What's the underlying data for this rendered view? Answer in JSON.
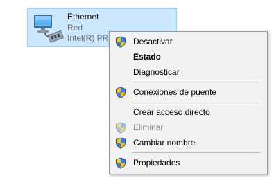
{
  "adapter": {
    "name": "Ethernet",
    "status": "Red",
    "device": "Intel(R) PRO"
  },
  "context_menu": {
    "items": [
      {
        "label": "Desactivar",
        "icon": "uac-shield-icon"
      },
      {
        "label": "Estado",
        "bold": true
      },
      {
        "label": "Diagnosticar"
      },
      {
        "label": "Conexiones de puente",
        "icon": "uac-shield-icon"
      },
      {
        "label": "Crear acceso directo"
      },
      {
        "label": "Eliminar",
        "icon": "uac-shield-icon",
        "disabled": true
      },
      {
        "label": "Cambiar nombre",
        "icon": "uac-shield-icon"
      },
      {
        "label": "Propiedades",
        "icon": "uac-shield-icon"
      }
    ]
  },
  "colors": {
    "selection_fill": "#cce8ff",
    "selection_border": "#99d1ff",
    "menu_bg": "#f2f2f2",
    "disabled_text": "#8c8c8c"
  }
}
